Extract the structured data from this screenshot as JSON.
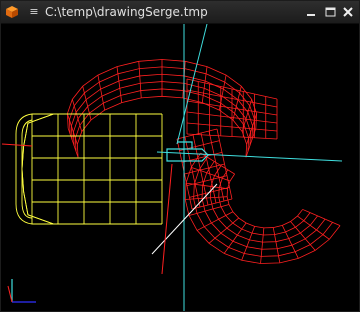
{
  "window": {
    "title": "C:\\temp\\drawingSerge.tmp",
    "menu_glyph": "≡",
    "icons": {
      "app": "orange-cube-icon",
      "menu": "window-menu-icon",
      "minimize": "minimize-icon",
      "maximize": "maximize-icon",
      "close": "close-icon"
    }
  },
  "viewport": {
    "background": "#000000",
    "colors": {
      "mesh_red": "#ff2020",
      "mesh_yellow": "#ffff40",
      "axis_cyan": "#40e0e0",
      "axis_white": "#ffffff",
      "triad_blue": "#3030ff"
    }
  }
}
